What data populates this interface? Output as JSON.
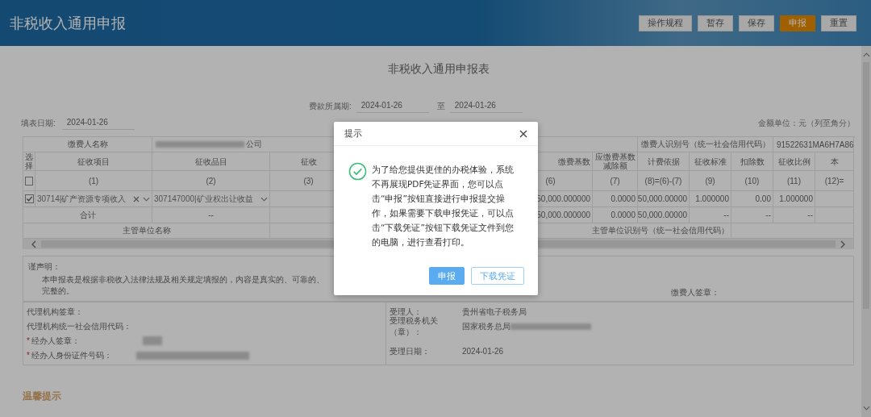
{
  "header": {
    "title": "非税收入通用申报",
    "buttons": [
      {
        "label": "操作规程",
        "primary": false
      },
      {
        "label": "暂存",
        "primary": false
      },
      {
        "label": "保存",
        "primary": false
      },
      {
        "label": "申报",
        "primary": true
      },
      {
        "label": "重置",
        "primary": false
      }
    ]
  },
  "form": {
    "title": "非税收入通用申报表",
    "period": {
      "label": "费款所属期:",
      "from": "2024-01-26",
      "separator": "至",
      "to": "2024-01-26"
    },
    "fill_date": {
      "label": "填表日期:",
      "value": "2024-01-26"
    },
    "unit_note": "金额单位：元（列至角分）"
  },
  "table": {
    "payer": {
      "name_label": "缴费人名称",
      "name_value": "公司",
      "id_label": "缴费人识别号（统一社会信用代码）",
      "id_value": "91522631MA6H7A86"
    },
    "columns": [
      "选择",
      "征收项目",
      "征收品目",
      "征收",
      "",
      "",
      "缴费基数",
      "应缴费基数减除额",
      "计费依据",
      "征收标准",
      "扣除数",
      "征收比例",
      "本"
    ],
    "index_row": {
      "checked": false,
      "cells": [
        "",
        "(1)",
        "(2)",
        "(3)",
        "",
        "",
        "(6)",
        "(7)",
        "(8)=(6)-(7)",
        "(9)",
        "(10)",
        "(11)",
        "(12)="
      ]
    },
    "rows": [
      {
        "checked": true,
        "cells": [
          "",
          "30714|矿产资源专项收入",
          "307147000|矿业权出让收益",
          "",
          "",
          "",
          "50,000.000000",
          "0.0000",
          "50,000.00000",
          "1.000000",
          "0.00",
          "1.000000",
          ""
        ]
      }
    ],
    "total": {
      "cells": [
        "合计",
        "",
        "--",
        "",
        "",
        "",
        "50,000.000000",
        "0.0000",
        "50,000.00000",
        "--",
        "--",
        "--",
        ""
      ]
    },
    "authority": {
      "name_label": "主管单位名称",
      "id_label": "主管单位识别号（统一社会信用代码）"
    }
  },
  "declaration": {
    "title": "谨声明：",
    "text": "本申报表是根据非税收入法律法规及相关规定填报的，内容是真实的、可靠的、完整的。",
    "signature_label": "缴费人签章："
  },
  "agent": {
    "left": [
      {
        "label": "代理机构签章："
      },
      {
        "label": "代理机构统一社会信用代码："
      },
      {
        "mark": "*",
        "label": "经办人签章："
      },
      {
        "mark": "*",
        "label": "经办人身份证件号码："
      }
    ],
    "right": [
      {
        "label": "受理人：",
        "value": "贵州省电子税务局"
      },
      {
        "label": "受理税务机关（章）：",
        "value": "国家税务总局"
      },
      {
        "label": "受理日期：",
        "value": "2024-01-26"
      }
    ]
  },
  "tip_title": "温馨提示",
  "dialog": {
    "title": "提示",
    "message": "为了给您提供更佳的办税体验，系统不再展现PDF凭证界面，您可以点击“申报”按钮直接进行申报提交操作，如果需要下载申报凭证，可以点击“下载凭证”按钮下载凭证文件到您的电脑，进行查看打印。",
    "buttons": [
      {
        "label": "申报",
        "primary": true
      },
      {
        "label": "下载凭证",
        "primary": false
      }
    ]
  }
}
